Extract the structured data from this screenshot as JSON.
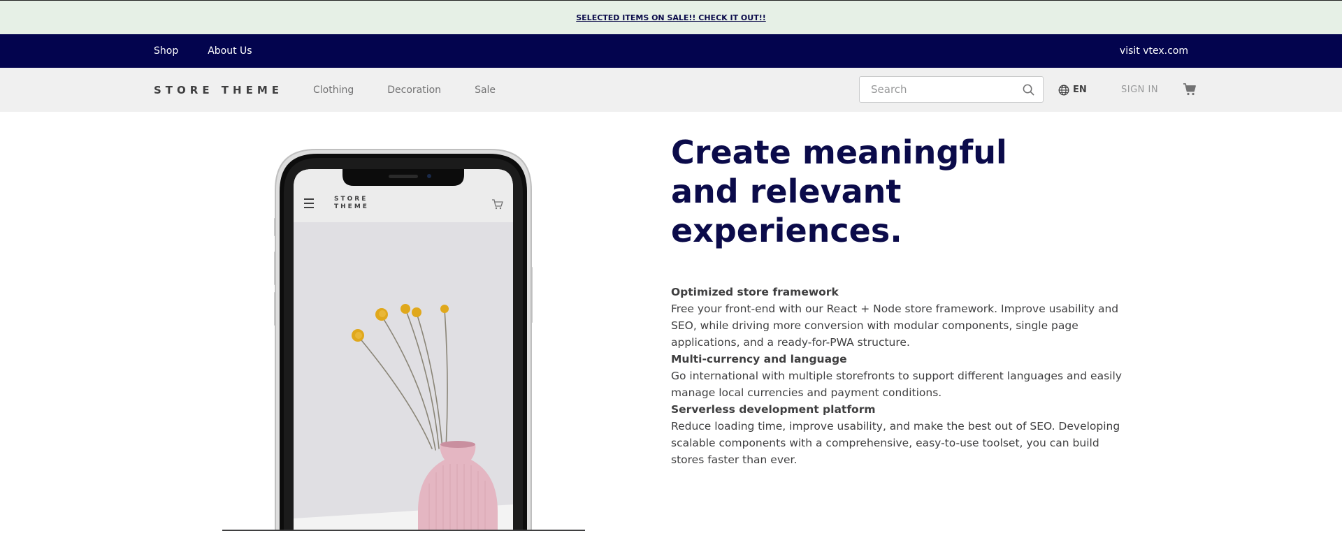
{
  "promo": {
    "text": "SELECTED ITEMS ON SALE!! CHECK IT OUT!!"
  },
  "topbar": {
    "links": [
      "Shop",
      "About Us"
    ],
    "visit": "visit vtex.com"
  },
  "header": {
    "logo": "STORE THEME",
    "menu": [
      "Clothing",
      "Decoration",
      "Sale"
    ],
    "search_placeholder": "Search",
    "language": "EN",
    "sign_in": "SIGN IN"
  },
  "phone_mock": {
    "logo_line1": "STORE",
    "logo_line2": "THEME"
  },
  "hero": {
    "title_line1": "Create meaningful",
    "title_line2": "and relevant",
    "title_line3": "experiences."
  },
  "features": [
    {
      "title": "Optimized store framework",
      "text": "Free your front-end with our React + Node store framework. Improve usability and SEO, while driving more conversion with modular components, single page applications, and a ready-for-PWA structure."
    },
    {
      "title": "Multi-currency and language",
      "text": "Go international with multiple storefronts to support different languages and easily manage local currencies and payment conditions."
    },
    {
      "title": "Serverless development platform",
      "text": "Reduce loading time, improve usability, and make the best out of SEO. Developing scalable components with a comprehensive, easy-to-use toolset, you can build stores faster than ever."
    }
  ],
  "colors": {
    "promo_bg": "#e6f0e6",
    "topbar_bg": "#03044e",
    "header_bg": "#f0f0f0",
    "title_color": "#0b0b4a"
  },
  "icons": [
    "search-icon",
    "globe-icon",
    "cart-icon",
    "hamburger-icon"
  ]
}
